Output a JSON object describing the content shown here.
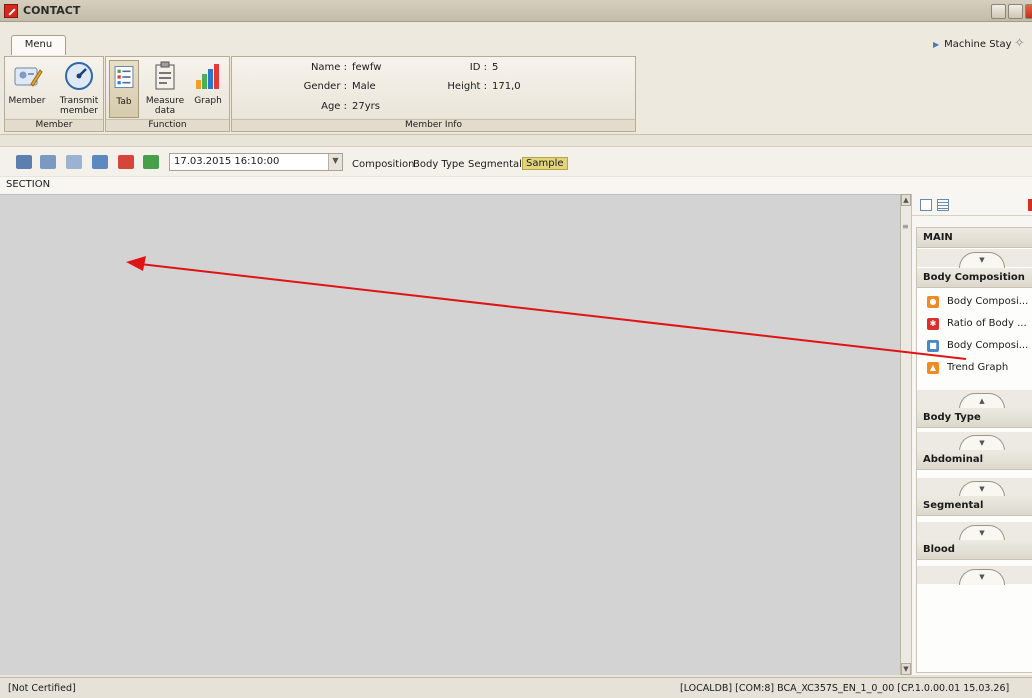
{
  "window": {
    "title": "CONTACT"
  },
  "menu": {
    "tab_label": "Menu",
    "machine_stay": "Machine Stay"
  },
  "ribbon": {
    "member_group": {
      "label": "Member",
      "member": "Member",
      "transmit_line1": "Transmit",
      "transmit_line2": "member"
    },
    "function_group": {
      "label": "Function",
      "tab": "Tab",
      "measure_line1": "Measure",
      "measure_line2": "data",
      "graph": "Graph"
    },
    "member_info": {
      "label": "Member Info",
      "name_label": "Name :",
      "name_value": "fewfw",
      "gender_label": "Gender :",
      "gender_value": "Male",
      "age_label": "Age :",
      "age_value": "27yrs",
      "id_label": "ID :",
      "id_value": "5",
      "height_label": "Height :",
      "height_value": "171,0"
    }
  },
  "toolbar": {
    "date_value": "17.03.2015 16:10:00",
    "links": [
      "Composition",
      "Body Type",
      "Segmental",
      "Sample"
    ],
    "selected_link": "Sample"
  },
  "section": {
    "label": "SECTION"
  },
  "sidebar": {
    "main_label": "MAIN",
    "sections": [
      {
        "label": "Body Composition"
      },
      {
        "label": "Body Type"
      },
      {
        "label": "Abdominal"
      },
      {
        "label": "Segmental"
      },
      {
        "label": "Blood"
      }
    ],
    "items": [
      {
        "label": "Body Composi...",
        "icon": "composition-icon",
        "color": "#f08a24"
      },
      {
        "label": "Ratio of Body ...",
        "icon": "ratio-icon",
        "color": "#d9302c"
      },
      {
        "label": "Body Composi...",
        "icon": "chart-icon",
        "color": "#4f86c6"
      },
      {
        "label": "Trend Graph",
        "icon": "trend-icon",
        "color": "#f08a24"
      }
    ]
  },
  "status": {
    "left": "[Not Certified]",
    "right": "[LOCALDB]   [COM:8]   BCA_XC357S_EN_1_0_00 [CP.1.0.00.01 15.03.26]"
  },
  "colors": {
    "accent": "#e3d47f",
    "arrow": "#e01414",
    "canvas": "#d3d3d3"
  }
}
